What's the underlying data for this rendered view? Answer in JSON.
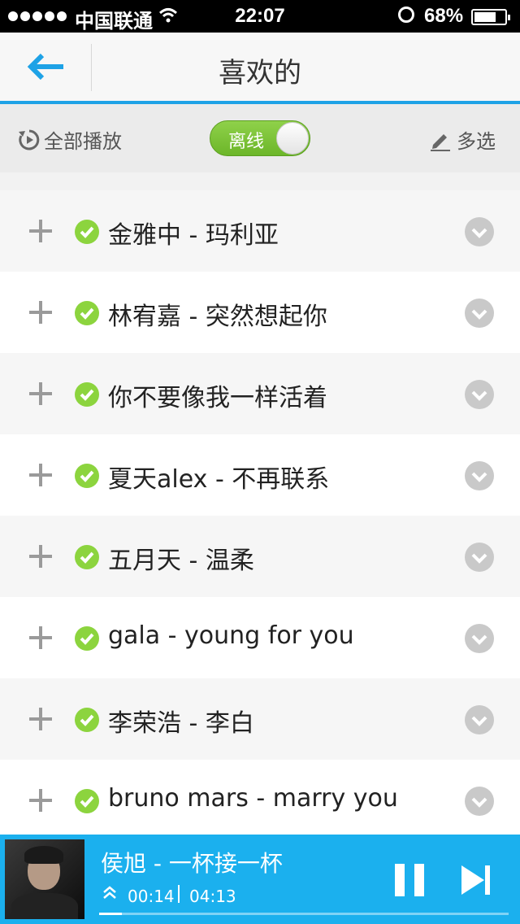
{
  "status_bar": {
    "carrier": "中国联通",
    "time": "22:07",
    "battery": "68%"
  },
  "header": {
    "title": "喜欢的",
    "back_icon": "back-arrow-icon",
    "accent_color": "#1ea2e6"
  },
  "toolbar": {
    "play_all_label": "全部播放",
    "offline_toggle_label": "离线",
    "offline_on": true,
    "multi_select_label": "多选"
  },
  "songs": [
    {
      "title": "金雅中 - 玛利亚"
    },
    {
      "title": "林宥嘉 - 突然想起你"
    },
    {
      "title": "你不要像我一样活着"
    },
    {
      "title": "夏天alex - 不再联系"
    },
    {
      "title": "五月天 - 温柔"
    },
    {
      "title": "gala - young for you"
    },
    {
      "title": "李荣浩 - 李白"
    },
    {
      "title": "bruno mars - marry you"
    }
  ],
  "now_playing": {
    "title": "侯旭 - 一杯接一杯",
    "elapsed": "00:14",
    "total": "04:13",
    "progress": 0.055,
    "bar_color": "#1bb0ee"
  }
}
